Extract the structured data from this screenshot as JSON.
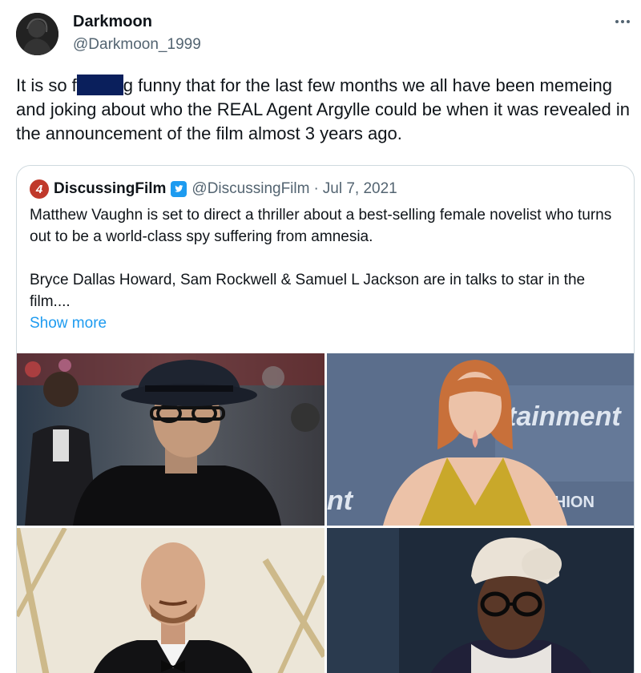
{
  "author": {
    "display_name": "Darkmoon",
    "handle": "@Darkmoon_1999"
  },
  "tweet": {
    "text_before": "It is so f",
    "text_after": "g funny that for the last few months we all have been memeing and joking about who the REAL Agent Argylle could be when it was revealed in the announcement of the film almost 3 years ago."
  },
  "quote": {
    "logo_letter": "4",
    "name": "DiscussingFilm",
    "handle": "@DiscussingFilm",
    "separator": "·",
    "date": "Jul 7, 2021",
    "paragraph1": "Matthew Vaughn is set to direct a thriller about a best-selling female novelist who turns out to be a world-class spy suffering from amnesia.",
    "paragraph2": "Bryce Dallas Howard, Sam Rockwell & Samuel L Jackson are in talks to star in the film....",
    "show_more": "Show more"
  },
  "photos": {
    "photo2_sign_text_1": "tainment",
    "photo2_sign_text_2": "FASHION",
    "photo2_sign_text_3": "nt"
  },
  "colors": {
    "link": "#1d9bf0",
    "secondary_text": "#536471",
    "redaction": "#0a1f5c",
    "logo": "#c0392b"
  }
}
